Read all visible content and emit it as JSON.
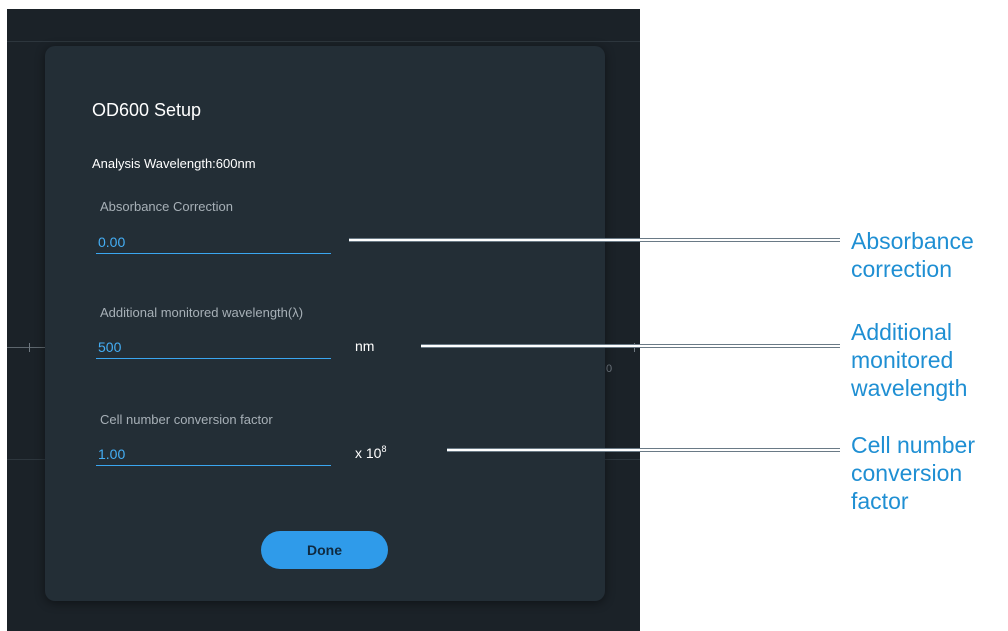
{
  "dialog": {
    "title": "OD600 Setup",
    "analysis_wavelength": "Analysis Wavelength:600nm",
    "fields": {
      "absorbance_correction": {
        "label": "Absorbance Correction",
        "value": "0.00"
      },
      "additional_wavelength": {
        "label": "Additional monitored wavelength(λ)",
        "value": "500",
        "unit": "nm"
      },
      "cell_conversion": {
        "label": "Cell number conversion factor",
        "value": "1.00",
        "unit_base": "x 10",
        "unit_exponent": "8"
      }
    },
    "done_label": "Done"
  },
  "background": {
    "axis_digit": "0"
  },
  "callouts": {
    "absorbance": [
      "Absorbance",
      "correction"
    ],
    "wavelength": [
      "Additional",
      "monitored",
      "wavelength"
    ],
    "cell_number": [
      "Cell number",
      "conversion",
      "factor"
    ]
  },
  "colors": {
    "app_background": "#1b2228",
    "dialog_background": "#232e36",
    "accent": "#2f9bea",
    "input_text": "#44aef5",
    "callout_text": "#1f8fd3"
  }
}
